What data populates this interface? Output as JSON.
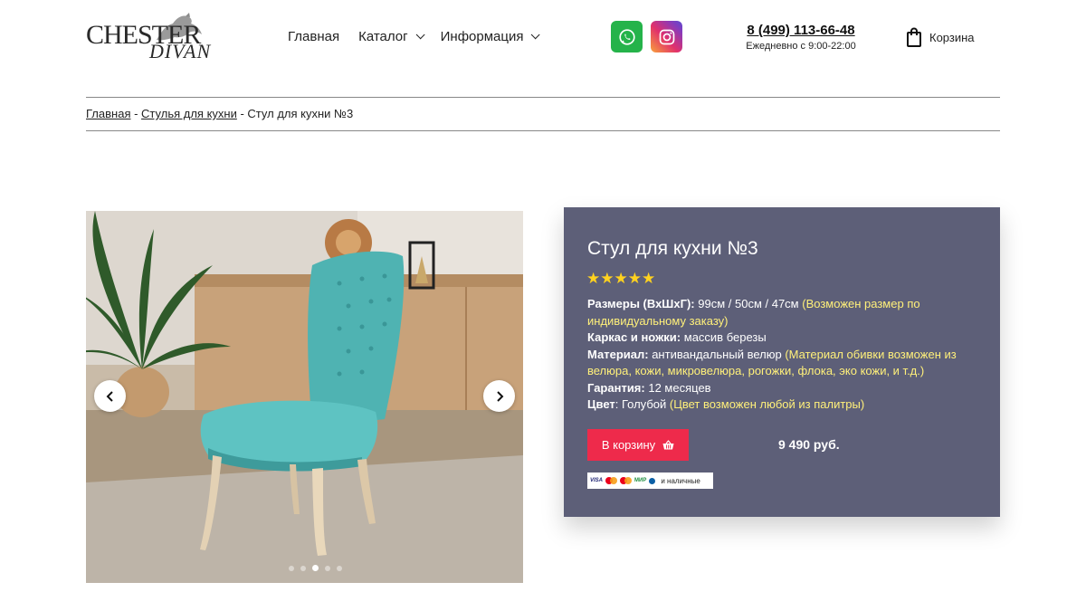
{
  "header": {
    "logo": {
      "line1": "CHESTER",
      "line2": "DIVAN"
    },
    "nav": [
      {
        "label": "Главная",
        "has_dropdown": false
      },
      {
        "label": "Каталог",
        "has_dropdown": true
      },
      {
        "label": "Информация",
        "has_dropdown": true
      }
    ],
    "social": [
      {
        "icon": "whatsapp-icon",
        "color": "#25b34a"
      },
      {
        "icon": "instagram-icon",
        "color": "#e1306c"
      }
    ],
    "phone": "8 (499) 113-66-48",
    "hours": "Ежедневно с 9:00-22:00",
    "cart_label": "Корзина"
  },
  "breadcrumb": {
    "home": "Главная",
    "sep": " - ",
    "category": "Стулья для кухни",
    "current": "Стул для кухни №3"
  },
  "gallery": {
    "slide_count": 5,
    "active_slide": 3
  },
  "product": {
    "title": "Стул для кухни №3",
    "rating_stars": "★★★★★",
    "rating": 5,
    "specs": {
      "size_label": "Размеры (ВхШхГ):",
      "size_value": "99см / 50см / 47см",
      "size_note": "(Возможен размер по индивидуальному заказу)",
      "frame_label": "Каркас и ножки:",
      "frame_value": "массив березы",
      "material_label": "Материал:",
      "material_value": "антивандальный велюр",
      "material_note": "(Материал обивки возможен из велюра, кожи, микровелюра, рогожки, флока, эко кожи, и т.д.)",
      "warranty_label": "Гарантия:",
      "warranty_value": "12 месяцев",
      "color_label": "Цвет",
      "color_value": ": Голубой",
      "color_note": "(Цвет возможен любой из палитры)"
    },
    "buy_label": "В корзину",
    "price": "9 490 руб.",
    "payments": {
      "visa": "VISA",
      "mir": "МИР",
      "cash": "и наличные"
    }
  },
  "colors": {
    "panel_bg": "#5d5f78",
    "accent_button": "#ee2a4b",
    "note_yellow": "#fff07a",
    "stars": "#ffd21f"
  }
}
